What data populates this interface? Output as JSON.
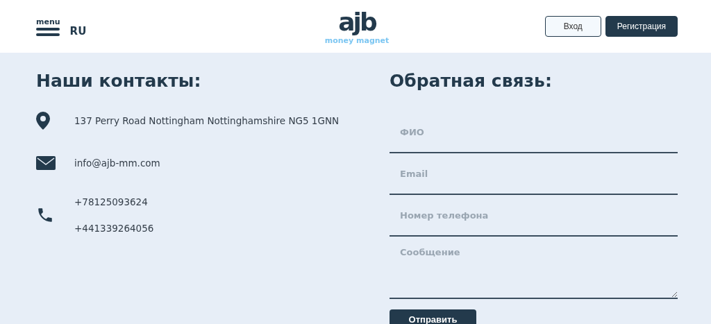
{
  "header": {
    "menu_label": "menu",
    "language": "RU",
    "logo": {
      "mark": "ajb",
      "tagline": "money magnet"
    },
    "buttons": [
      {
        "label": "Вход",
        "kind": "outline"
      },
      {
        "label": "Регистрация",
        "kind": "filled"
      }
    ]
  },
  "contacts": {
    "title": "Наши контакты:",
    "items": [
      {
        "kind": "address",
        "lines": [
          "137 Perry Road Nottingham Nottinghamshire NG5 1GNN"
        ]
      },
      {
        "kind": "email",
        "lines": [
          "info@ajb-mm.com"
        ]
      },
      {
        "kind": "phone",
        "lines": [
          "+78125093624",
          "+441339264056"
        ]
      }
    ]
  },
  "feedback": {
    "title": "Обратная связь:",
    "fields": [
      {
        "placeholder": "ФИО",
        "kind": "input"
      },
      {
        "placeholder": "Email",
        "kind": "input"
      },
      {
        "placeholder": "Номер телефона",
        "kind": "input"
      },
      {
        "placeholder": "Сообщение",
        "kind": "textarea"
      }
    ],
    "submit": "Отправить"
  }
}
